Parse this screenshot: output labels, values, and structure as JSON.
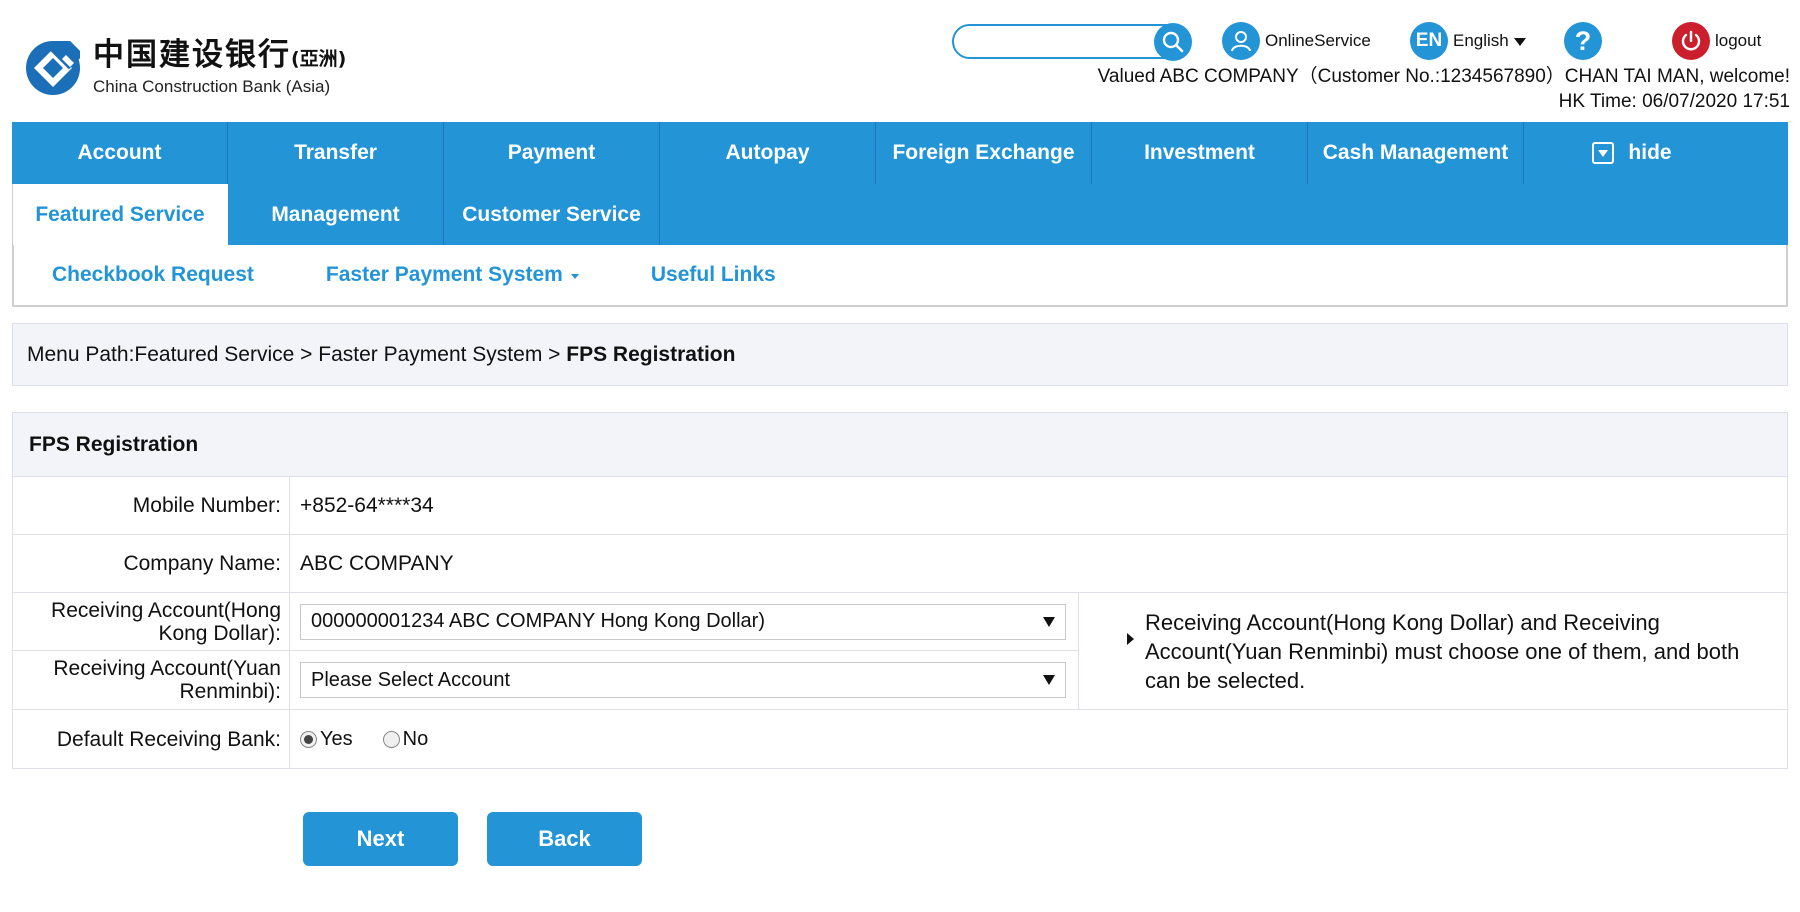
{
  "brand": {
    "name_cn": "中国建设银行",
    "name_cn_suffix": "(亞洲)",
    "name_en": "China Construction Bank (Asia)",
    "color": "#2394d6"
  },
  "header": {
    "search": {
      "value": "",
      "placeholder": ""
    },
    "online_service": "OnlineService",
    "language_code": "EN",
    "language_label": "English",
    "help_symbol": "?",
    "logout": "logout",
    "welcome_line": "Valued ABC COMPANY（Customer No.:1234567890）CHAN TAI MAN, welcome!",
    "time_line": "HK Time: 06/07/2020 17:51"
  },
  "nav": {
    "row1": [
      "Account",
      "Transfer",
      "Payment",
      "Autopay",
      "Foreign Exchange",
      "Investment",
      "Cash Management"
    ],
    "hide_label": "hide",
    "row2": [
      "Featured Service",
      "Management",
      "Customer Service"
    ],
    "active": "Featured Service"
  },
  "subnav": {
    "items": [
      "Checkbook Request",
      "Faster Payment System",
      "Useful Links"
    ]
  },
  "breadcrumb": {
    "prefix": "Menu Path:Featured Service > Faster Payment System > ",
    "current": "FPS Registration"
  },
  "form": {
    "title": "FPS Registration",
    "mobile_label": "Mobile Number:",
    "mobile_value": "+852-64****34",
    "company_label": "Company Name:",
    "company_value": "ABC COMPANY",
    "hkd_label": "Receiving Account(Hong Kong Dollar):",
    "hkd_value": "000000001234 ABC COMPANY Hong Kong Dollar)",
    "rmb_label": "Receiving Account(Yuan Renminbi):",
    "rmb_value": "Please Select Account",
    "note": "Receiving Account(Hong Kong Dollar) and Receiving Account(Yuan Renminbi) must choose one of them, and both can be selected.",
    "bank_label": "Default Receiving Bank:",
    "yes": "Yes",
    "no": "No",
    "default_bank_selected": "Yes"
  },
  "buttons": {
    "next": "Next",
    "back": "Back"
  }
}
